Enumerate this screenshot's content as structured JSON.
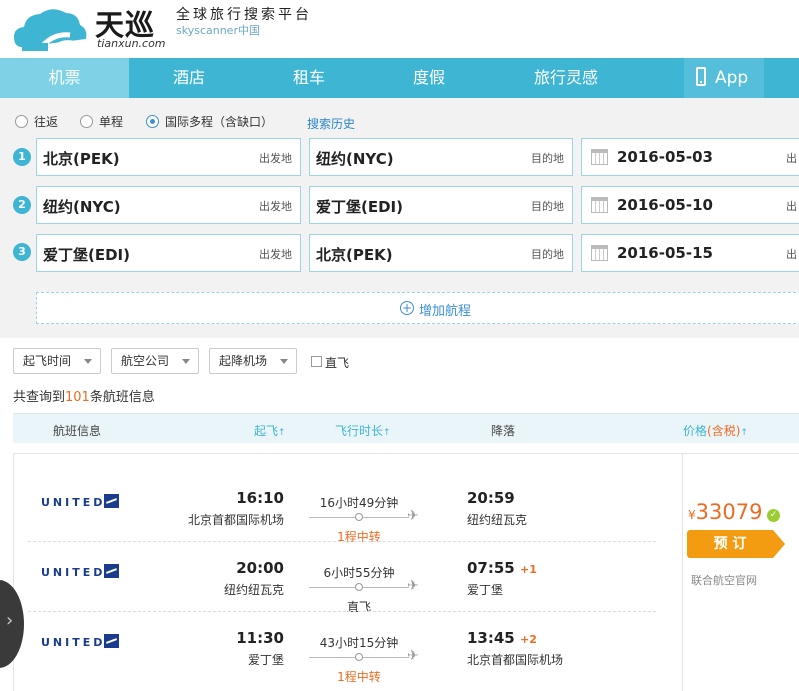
{
  "brand": {
    "name_cn": "天巡",
    "domain": "tianxun.com",
    "tagline": "全球旅行搜索平台",
    "sub_tag": "skyscanner中国",
    "color": "#3fb5d4"
  },
  "nav": {
    "items": [
      {
        "label": "机票",
        "active": true
      },
      {
        "label": "酒店"
      },
      {
        "label": "租车"
      },
      {
        "label": "度假"
      },
      {
        "label": "旅行灵感"
      }
    ],
    "app_label": "App"
  },
  "search": {
    "trip_types": [
      {
        "label": "往返",
        "selected": false
      },
      {
        "label": "单程",
        "selected": false
      },
      {
        "label": "国际多程（含缺口）",
        "selected": true
      }
    ],
    "history_link": "搜索历史",
    "legs": [
      {
        "num": "1",
        "from": "北京(PEK)",
        "to": "纽约(NYC)",
        "date": "2016-05-03"
      },
      {
        "num": "2",
        "from": "纽约(NYC)",
        "to": "爱丁堡(EDI)",
        "date": "2016-05-10"
      },
      {
        "num": "3",
        "from": "爱丁堡(EDI)",
        "to": "北京(PEK)",
        "date": "2016-05-15"
      }
    ],
    "from_tag": "出发地",
    "to_tag": "目的地",
    "date_tag": "出",
    "add_leg": "增加航程"
  },
  "filters": {
    "departure_time": "起飞时间",
    "airline": "航空公司",
    "airport": "起降机场",
    "direct": "直飞"
  },
  "results_summary": {
    "prefix": "共查询到",
    "count": "101",
    "suffix": "条航班信息"
  },
  "columns": {
    "flight_info": "航班信息",
    "depart": "起飞",
    "duration": "飞行时长",
    "arrive": "降落",
    "price": "价格",
    "tax": "(含税)",
    "sort_arrow": "↑"
  },
  "result": {
    "segments": [
      {
        "airline": "UNITED",
        "dep_time": "16:10",
        "dep_city": "北京首都国际机场",
        "duration": "16小时49分钟",
        "stops": "1程中转",
        "stop_type": "transfer",
        "arr_time": "20:59",
        "arr_plus": "",
        "arr_city": "纽约纽瓦克"
      },
      {
        "airline": "UNITED",
        "dep_time": "20:00",
        "dep_city": "纽约纽瓦克",
        "duration": "6小时55分钟",
        "stops": "直飞",
        "stop_type": "direct",
        "arr_time": "07:55",
        "arr_plus": "+1",
        "arr_city": "爱丁堡"
      },
      {
        "airline": "UNITED",
        "dep_time": "11:30",
        "dep_city": "爱丁堡",
        "duration": "43小时15分钟",
        "stops": "1程中转",
        "stop_type": "transfer",
        "arr_time": "13:45",
        "arr_plus": "+2",
        "arr_city": "北京首都国际机场"
      }
    ],
    "price_symbol": "¥",
    "price": "33079",
    "book_label": "预 订",
    "provider": "联合航空官网"
  }
}
